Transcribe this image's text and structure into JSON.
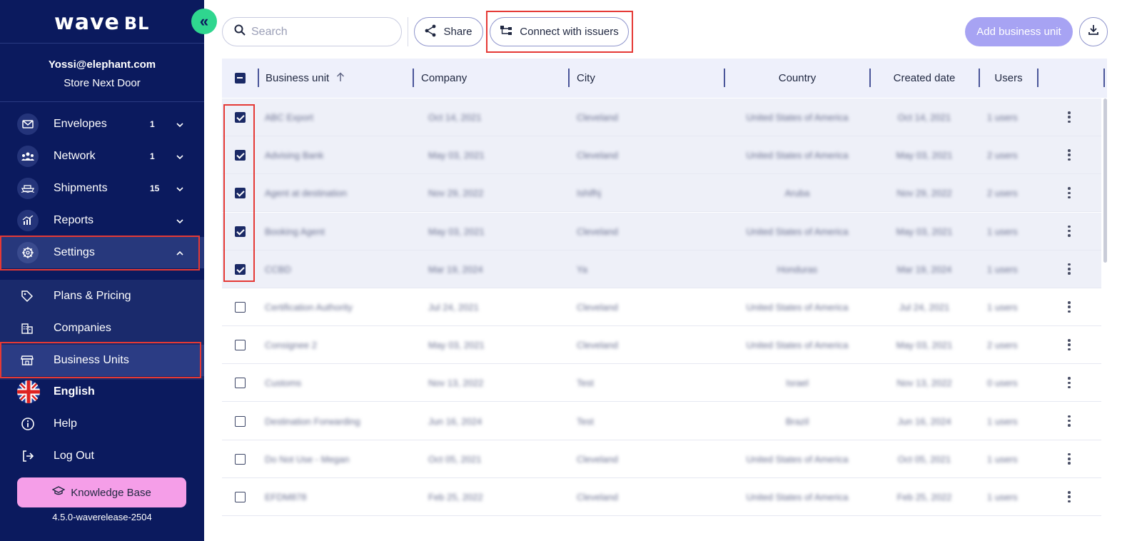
{
  "app": {
    "logo_main": "wave",
    "logo_suffix": "BL",
    "collapse_glyph": "«"
  },
  "user": {
    "email": "Yossi@elephant.com",
    "store": "Store Next Door"
  },
  "nav": {
    "envelopes": {
      "label": "Envelopes",
      "count": "1",
      "icon": "envelope-icon"
    },
    "network": {
      "label": "Network",
      "count": "1",
      "icon": "network-icon"
    },
    "shipments": {
      "label": "Shipments",
      "count": "15",
      "icon": "ship-icon"
    },
    "reports": {
      "label": "Reports",
      "icon": "chart-icon"
    },
    "settings": {
      "label": "Settings",
      "icon": "gear-icon"
    },
    "plans": {
      "label": "Plans & Pricing",
      "icon": "tag-icon"
    },
    "companies": {
      "label": "Companies",
      "icon": "building-icon"
    },
    "business_units": {
      "label": "Business Units",
      "icon": "store-icon"
    },
    "language": {
      "label": "English",
      "icon": "uk-flag-icon"
    },
    "help": {
      "label": "Help",
      "icon": "info-icon"
    },
    "logout": {
      "label": "Log Out",
      "icon": "logout-icon"
    }
  },
  "knowledge_base": {
    "label": "Knowledge Base"
  },
  "version": "4.5.0-waverelease-2504",
  "toolbar": {
    "search_placeholder": "Search",
    "share_label": "Share",
    "connect_label": "Connect with issuers",
    "add_label": "Add business unit"
  },
  "table": {
    "columns": {
      "business_unit": "Business unit",
      "company": "Company",
      "city": "City",
      "country": "Country",
      "created": "Created date",
      "users": "Users"
    },
    "rows": [
      {
        "selected": true,
        "name": "ABC Export",
        "company": "Oct 14, 2021",
        "city": "Cleveland",
        "country": "United States of America",
        "created": "Oct 14, 2021",
        "users": "1 users"
      },
      {
        "selected": true,
        "name": "Advising Bank",
        "company": "May 03, 2021",
        "city": "Cleveland",
        "country": "United States of America",
        "created": "May 03, 2021",
        "users": "2 users"
      },
      {
        "selected": true,
        "name": "Agent at destination",
        "company": "Nov 29, 2022",
        "city": "Ishifhj",
        "country": "Aruba",
        "created": "Nov 29, 2022",
        "users": "2 users"
      },
      {
        "selected": true,
        "name": "Booking Agent",
        "company": "May 03, 2021",
        "city": "Cleveland",
        "country": "United States of America",
        "created": "May 03, 2021",
        "users": "1 users"
      },
      {
        "selected": true,
        "name": "CCBD",
        "company": "Mar 19, 2024",
        "city": "Ya",
        "country": "Honduras",
        "created": "Mar 19, 2024",
        "users": "1 users"
      },
      {
        "selected": false,
        "name": "Certification Authority",
        "company": "Jul 24, 2021",
        "city": "Cleveland",
        "country": "United States of America",
        "created": "Jul 24, 2021",
        "users": "1 users"
      },
      {
        "selected": false,
        "name": "Consignee 2",
        "company": "May 03, 2021",
        "city": "Cleveland",
        "country": "United States of America",
        "created": "May 03, 2021",
        "users": "2 users"
      },
      {
        "selected": false,
        "name": "Customs",
        "company": "Nov 13, 2022",
        "city": "Test",
        "country": "Israel",
        "created": "Nov 13, 2022",
        "users": "0 users"
      },
      {
        "selected": false,
        "name": "Destination Forwarding",
        "company": "Jun 16, 2024",
        "city": "Test",
        "country": "Brazil",
        "created": "Jun 16, 2024",
        "users": "1 users"
      },
      {
        "selected": false,
        "name": "Do Not Use - Megan",
        "company": "Oct 05, 2021",
        "city": "Cleveland",
        "country": "United States of America",
        "created": "Oct 05, 2021",
        "users": "1 users"
      },
      {
        "selected": false,
        "name": "EFDM878",
        "company": "Feb 25, 2022",
        "city": "Cleveland",
        "country": "United States of America",
        "created": "Feb 25, 2022",
        "users": "1 users"
      }
    ]
  },
  "colors": {
    "sidebar_bg": "#0b1a5e",
    "accent_green": "#2fd68f",
    "add_button": "#a7a3f3",
    "knowledge_base": "#f59ee8",
    "highlight_red": "#e53935"
  }
}
